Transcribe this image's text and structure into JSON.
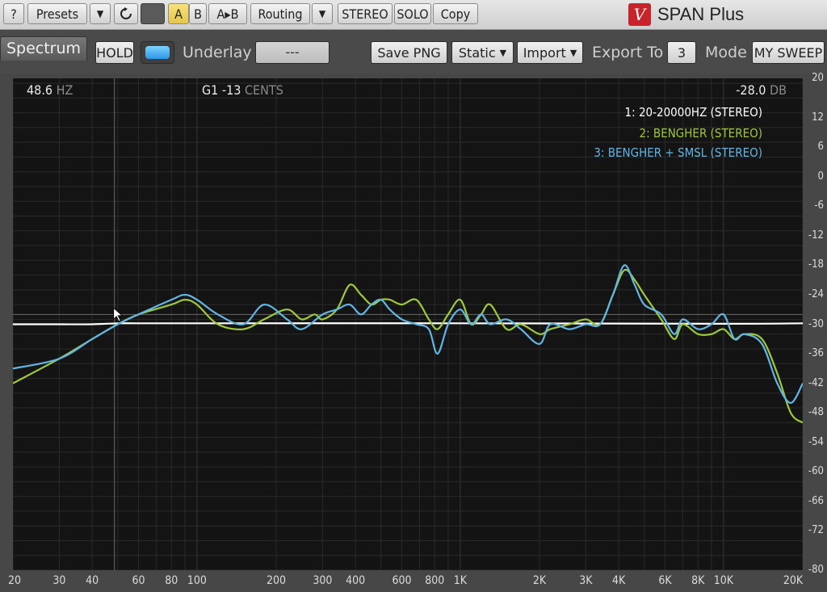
{
  "toolbar": {
    "help_label": "?",
    "presets_label": "Presets",
    "presets_dropdown": "▼",
    "undo_icon": "undo-icon",
    "a_label": "A",
    "b_label": "B",
    "atob_label": "A▸B",
    "routing_label": "Routing",
    "routing_dropdown": "▼",
    "stereo_label": "STEREO",
    "solo_label": "SOLO",
    "copy_label": "Copy",
    "logo_glyph": "V",
    "brand": "SPAN Plus"
  },
  "bar2": {
    "tab_label": "Spectrum",
    "hold_label": "HOLD",
    "underlay_label": "Underlay",
    "underlay_value": "---",
    "save_png_label": "Save PNG",
    "static_label": "Static",
    "import_label": "Import",
    "export_label": "Export To",
    "export_value": "3",
    "mode_label": "Mode",
    "mode_value": "MY SWEEP"
  },
  "readouts": {
    "freq_value": "48.6",
    "freq_unit": "HZ",
    "note_value": "G1",
    "cents_value": "-13",
    "cents_unit": "CENTS",
    "db_value": "-28.0",
    "db_unit": "DB"
  },
  "colors": {
    "trace1": "#ffffff",
    "trace2": "#9fc93a",
    "trace3": "#62b6e6",
    "background": "#141414"
  },
  "chart_data": {
    "type": "line",
    "x_scale": "log",
    "xlim": [
      20,
      20000
    ],
    "ylim": [
      -80,
      20
    ],
    "x_ticks": [
      20,
      30,
      40,
      60,
      80,
      100,
      200,
      300,
      400,
      600,
      800,
      1000,
      2000,
      3000,
      4000,
      6000,
      8000,
      10000,
      20000
    ],
    "x_tick_labels": [
      "20",
      "30",
      "40",
      "60",
      "80",
      "100",
      "200",
      "300",
      "400",
      "600",
      "800",
      "1K",
      "2K",
      "3K",
      "4K",
      "6K",
      "8K",
      "10K",
      "20K"
    ],
    "y_ticks": [
      20,
      12,
      6,
      0,
      -6,
      -12,
      -18,
      -24,
      -30,
      -36,
      -42,
      -48,
      -54,
      -60,
      -66,
      -72,
      -80
    ],
    "grid": true,
    "legend_position": "top-right",
    "series": [
      {
        "name": "1: 20-20000HZ (STEREO)",
        "color": "#ffffff",
        "x": [
          20,
          30,
          40,
          50,
          60,
          100,
          1000,
          10000,
          20000
        ],
        "y": [
          -30,
          -30,
          -30,
          -29.8,
          -29.8,
          -29.8,
          -29.8,
          -29.9,
          -29.8
        ]
      },
      {
        "name": "2: BENGHER (STEREO)",
        "color": "#9fc93a",
        "x": [
          20,
          30,
          40,
          50,
          60,
          80,
          90,
          100,
          120,
          150,
          180,
          220,
          250,
          280,
          300,
          340,
          380,
          420,
          460,
          500,
          540,
          600,
          680,
          760,
          820,
          900,
          1000,
          1100,
          1200,
          1300,
          1500,
          1700,
          2000,
          2200,
          2600,
          3000,
          3400,
          3800,
          4200,
          4600,
          5000,
          5800,
          6500,
          7000,
          8000,
          9000,
          10000,
          11000,
          12000,
          14000,
          16000,
          18000,
          20000
        ],
        "y": [
          -42,
          -37,
          -33,
          -30,
          -28,
          -26,
          -25,
          -26,
          -30,
          -31,
          -29,
          -27,
          -29,
          -28,
          -29,
          -27,
          -22,
          -24,
          -26,
          -25,
          -25,
          -26,
          -25,
          -29,
          -31,
          -28,
          -25,
          -30,
          -28,
          -26,
          -31,
          -30,
          -32,
          -31,
          -30,
          -29,
          -30,
          -24,
          -19,
          -21,
          -24,
          -29,
          -33,
          -30,
          -32,
          -32,
          -31,
          -33,
          -32,
          -33,
          -40,
          -48,
          -50
        ]
      },
      {
        "name": "3: BENGHER + SMSL (STEREO)",
        "color": "#62b6e6",
        "x": [
          20,
          30,
          40,
          50,
          60,
          80,
          90,
          100,
          120,
          150,
          180,
          220,
          250,
          300,
          340,
          380,
          420,
          460,
          500,
          540,
          600,
          680,
          760,
          820,
          900,
          1000,
          1100,
          1200,
          1300,
          1500,
          1700,
          2000,
          2200,
          2600,
          3000,
          3400,
          3800,
          4200,
          4600,
          5000,
          5800,
          6500,
          7000,
          8000,
          9000,
          10000,
          11000,
          12000,
          14000,
          16000,
          18000,
          20000
        ],
        "y": [
          -39,
          -37,
          -33,
          -30,
          -28,
          -25,
          -24,
          -25,
          -28,
          -30,
          -26,
          -29,
          -31,
          -28,
          -27,
          -26,
          -28,
          -26,
          -25,
          -27,
          -29,
          -30,
          -31,
          -36,
          -30,
          -27,
          -30,
          -28,
          -30,
          -29,
          -31,
          -34,
          -30,
          -31,
          -30,
          -30,
          -24,
          -18,
          -22,
          -26,
          -28,
          -32,
          -29,
          -31,
          -30,
          -28,
          -33,
          -32,
          -34,
          -42,
          -46,
          -42
        ]
      }
    ]
  }
}
